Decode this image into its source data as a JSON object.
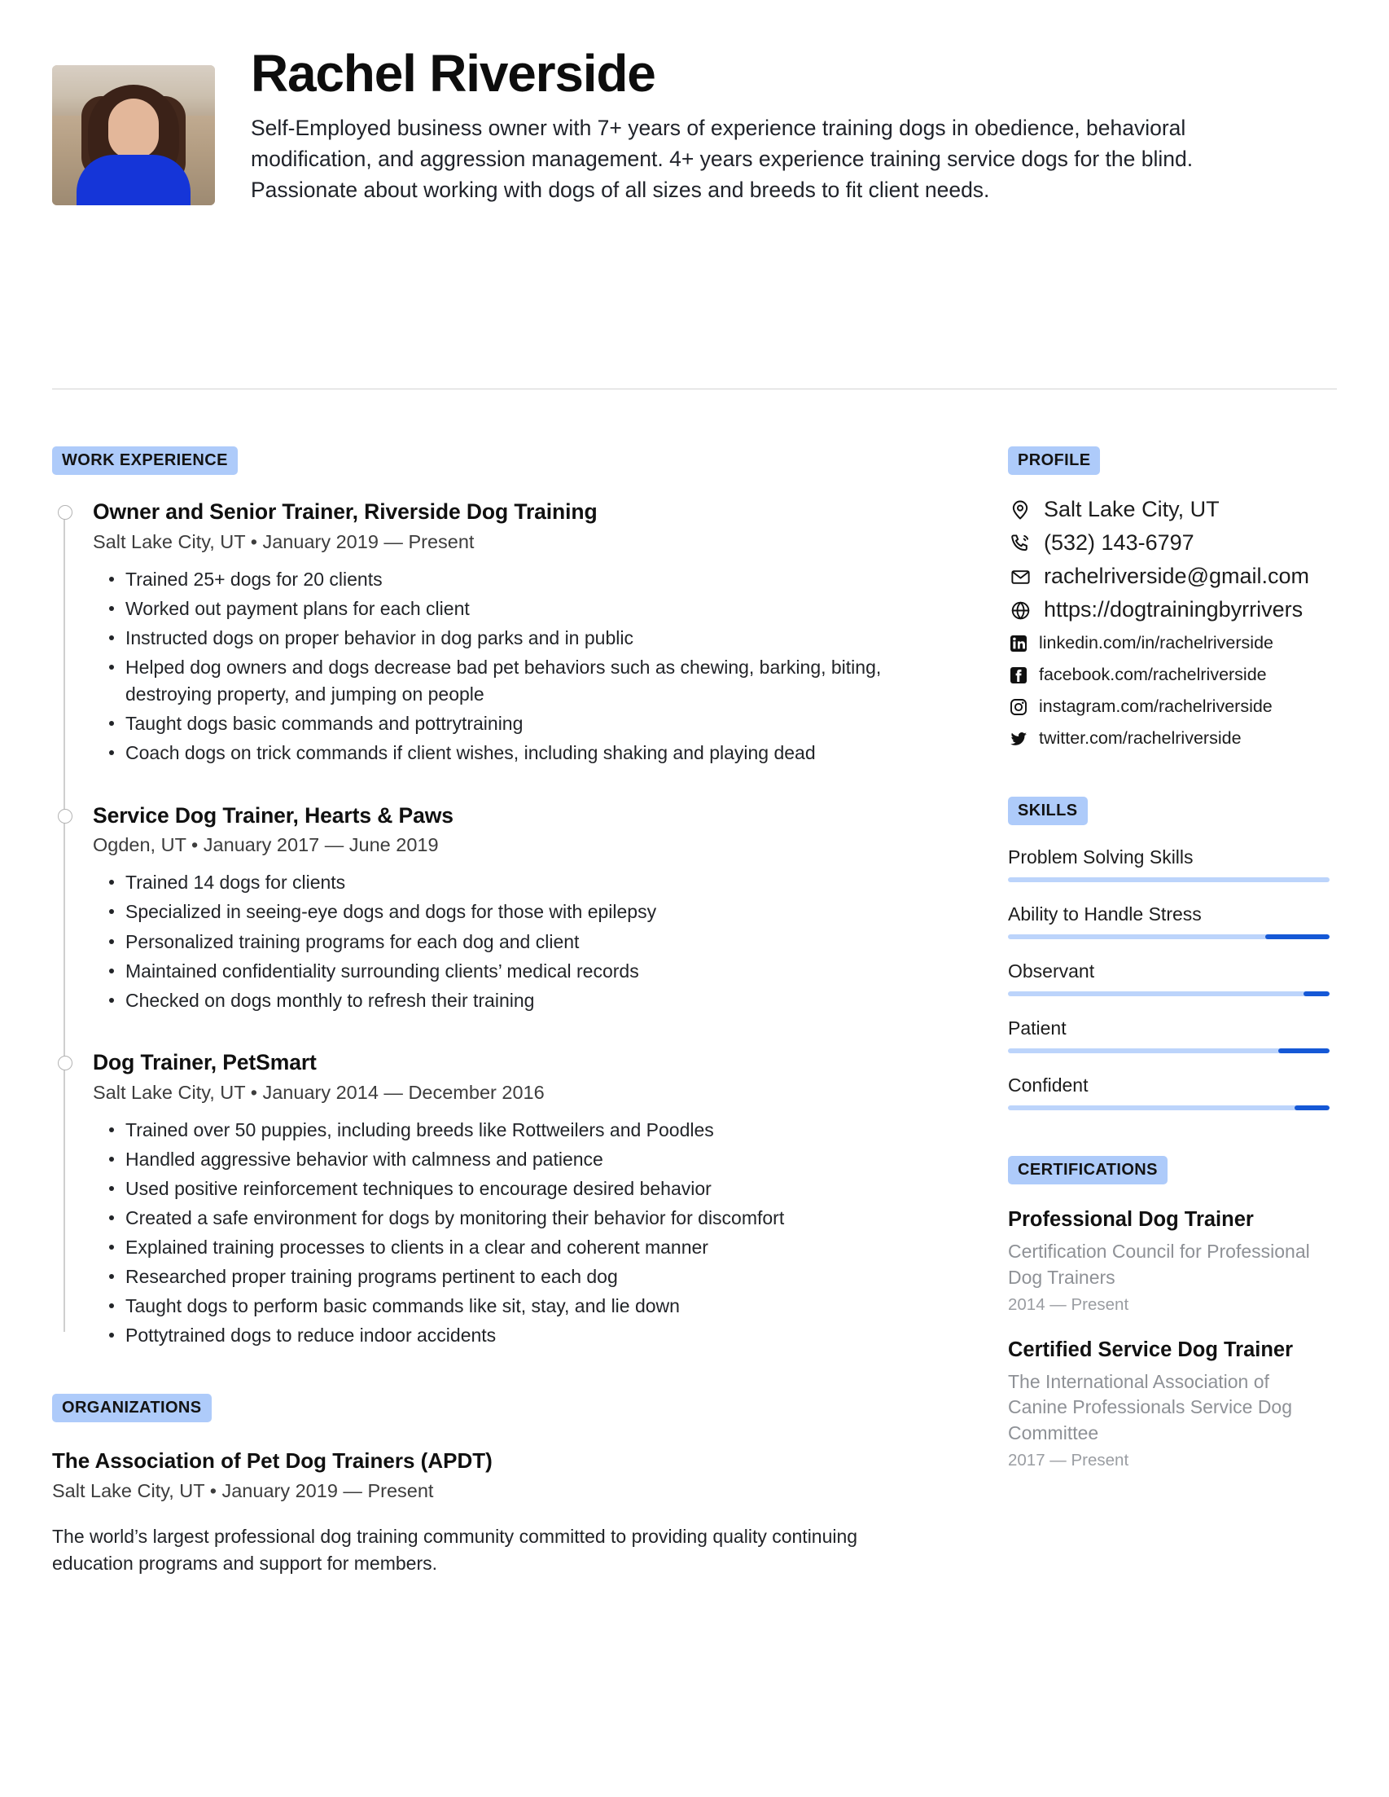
{
  "header": {
    "name": "Rachel Riverside",
    "summary": "Self-Employed business owner with 7+ years of experience training dogs in obedience, behavioral modification, and aggression management. 4+ years experience training service dogs for the blind. Passionate about working with dogs of all sizes and breeds to fit client needs.",
    "avatar_alt": "portrait-photo"
  },
  "colors": {
    "badge_bg": "#aecbfa",
    "skill_track": "#bcd4fb",
    "skill_fill": "#1558d6",
    "muted_text": "#8e9196"
  },
  "sections": {
    "work_experience_label": "WORK EXPERIENCE",
    "organizations_label": "ORGANIZATIONS",
    "profile_label": "PROFILE",
    "skills_label": "SKILLS",
    "certifications_label": "CERTIFICATIONS"
  },
  "work_experience": [
    {
      "title": "Owner and Senior Trainer, Riverside Dog Training",
      "meta": "Salt Lake City, UT • January 2019 — Present",
      "bullets": [
        "Trained 25+ dogs for 20 clients",
        "Worked out payment plans for each client",
        "Instructed dogs on proper behavior in dog parks and in public",
        "Helped dog owners and dogs decrease bad pet behaviors such as chewing, barking, biting, destroying property, and jumping on people",
        "Taught dogs basic commands and pottrytraining",
        "Coach dogs on trick commands if client wishes, including shaking and playing dead"
      ]
    },
    {
      "title": "Service Dog Trainer, Hearts & Paws",
      "meta": "Ogden, UT • January 2017 — June 2019",
      "bullets": [
        "Trained 14 dogs for clients",
        "Specialized in seeing-eye dogs and dogs for those with epilepsy",
        "Personalized training programs for each dog and client",
        "Maintained confidentiality surrounding clients’ medical records",
        "Checked on dogs monthly to refresh their training"
      ]
    },
    {
      "title": "Dog Trainer, PetSmart",
      "meta": "Salt Lake City, UT • January 2014 — December 2016",
      "bullets": [
        "Trained over 50 puppies, including breeds like Rottweilers and Poodles",
        "Handled aggressive behavior with calmness and patience",
        "Used positive reinforcement techniques to encourage desired behavior",
        "Created a safe environment for dogs by monitoring their behavior for discomfort",
        "Explained training processes to clients in a clear and coherent manner",
        "Researched proper training programs pertinent to each dog",
        "Taught dogs to perform basic commands like sit, stay, and lie down",
        "Pottytrained dogs to reduce indoor accidents"
      ]
    }
  ],
  "organizations": [
    {
      "title": "The Association of Pet Dog Trainers (APDT)",
      "meta": "Salt Lake City, UT • January 2019 — Present",
      "description": "The world’s largest professional dog training community committed to providing quality continuing education programs and support for members."
    }
  ],
  "profile": {
    "contacts": [
      {
        "icon": "location-pin-icon",
        "value": "Salt Lake City, UT",
        "size": "large"
      },
      {
        "icon": "phone-icon",
        "value": "(532) 143-6797",
        "size": "large"
      },
      {
        "icon": "envelope-icon",
        "value": "rachelriverside@gmail.com",
        "size": "large"
      },
      {
        "icon": "globe-icon",
        "value": "https://dogtrainingbyrrivers",
        "size": "large"
      },
      {
        "icon": "linkedin-icon",
        "value": "linkedin.com/in/rachelriverside",
        "size": "small"
      },
      {
        "icon": "facebook-icon",
        "value": "facebook.com/rachelriverside",
        "size": "small"
      },
      {
        "icon": "instagram-icon",
        "value": "instagram.com/rachelriverside",
        "size": "small"
      },
      {
        "icon": "twitter-icon",
        "value": "twitter.com/rachelriverside",
        "size": "small"
      }
    ]
  },
  "skills": [
    {
      "name": "Problem Solving Skills",
      "level": 0
    },
    {
      "name": "Ability to Handle Stress",
      "level": 20
    },
    {
      "name": "Observant",
      "level": 8
    },
    {
      "name": "Patient",
      "level": 16
    },
    {
      "name": "Confident",
      "level": 11
    }
  ],
  "certifications": [
    {
      "name": "Professional Dog Trainer",
      "issuer": "Certification Council for Professional Dog Trainers",
      "dates": "2014 — Present"
    },
    {
      "name": "Certified Service Dog Trainer",
      "issuer": "The International Association of Canine Professionals Service Dog Committee",
      "dates": "2017 — Present"
    }
  ]
}
